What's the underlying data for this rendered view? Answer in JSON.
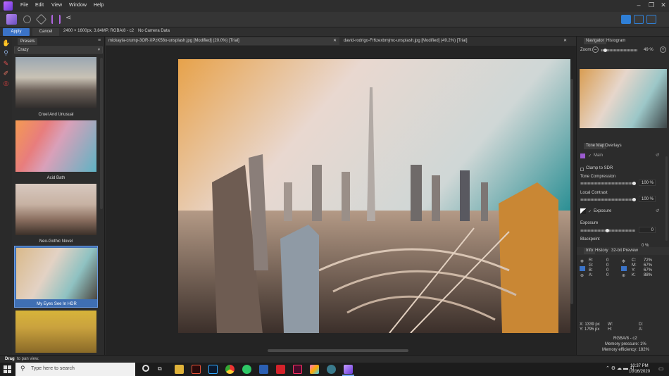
{
  "menubar": {
    "items": [
      "File",
      "Edit",
      "View",
      "Window",
      "Help"
    ]
  },
  "context": {
    "apply": "Apply",
    "cancel": "Cancel",
    "image_info": "2400 × 1600px, 3.84MP, RGBA/8 - c2",
    "camera": "No Camera Data"
  },
  "left_panel": {
    "tab": "Presets",
    "category": "Crazy",
    "presets": [
      {
        "label": "Cruel And Unusual"
      },
      {
        "label": "Acid Bath"
      },
      {
        "label": "Neo-Gothic Novel"
      },
      {
        "label": "My Eyes See In HDR"
      },
      {
        "label": ""
      }
    ]
  },
  "documents": {
    "tabs": [
      {
        "label": "mickayla-crump-3OR-XPzK58o-unsplash.jpg [Modified] (20.0%) [Trial]"
      },
      {
        "label": "david-rodrigo-Fr6zexbmjmc-unsplash.jpg [Modified] (49.2%) [Trial]"
      }
    ]
  },
  "navigator": {
    "tabs": [
      "Navigator",
      "Histogram"
    ],
    "zoom_label": "Zoom:",
    "zoom_value": "49 %"
  },
  "tonemap": {
    "tabs": [
      "Tone Map",
      "Overlays"
    ],
    "main_label": "Main",
    "clamp_label": "Clamp to SDR",
    "tone_compression_label": "Tone Compression",
    "tone_compression_value": "100 %",
    "tone_compression": 1.0,
    "local_contrast_label": "Local Contrast",
    "local_contrast_value": "100 %",
    "local_contrast": 1.0,
    "exposure_section": "Exposure",
    "exposure_label": "Exposure",
    "exposure_value": "0",
    "exposure": 0.5,
    "blackpoint_label": "Blackpoint",
    "blackpoint_value": "0 %"
  },
  "info": {
    "tabs": [
      "Info",
      "History",
      "32-bit Preview"
    ],
    "rgb": [
      {
        "k": "R:",
        "v": "0"
      },
      {
        "k": "G:",
        "v": "0"
      },
      {
        "k": "B:",
        "v": "0"
      },
      {
        "k": "A:",
        "v": "0"
      }
    ],
    "cmyk": [
      {
        "k": "C:",
        "v": "72%"
      },
      {
        "k": "M:",
        "v": "67%"
      },
      {
        "k": "Y:",
        "v": "67%"
      },
      {
        "k": "K:",
        "v": "88%"
      }
    ],
    "x": "X: 1339 px",
    "y": "Y: 1795 px",
    "w": "W:",
    "h": "H:",
    "d": "D:",
    "a": "A:",
    "format": "RGBA/8 - c2",
    "memory_pressure": "Memory pressure: 1%",
    "memory_efficiency": "Memory efficiency: 182%"
  },
  "status": {
    "bold": "Drag",
    "text": "to pan view."
  },
  "taskbar": {
    "search_placeholder": "Type here to search",
    "time": "10:37 PM",
    "date": "10/16/2020"
  }
}
